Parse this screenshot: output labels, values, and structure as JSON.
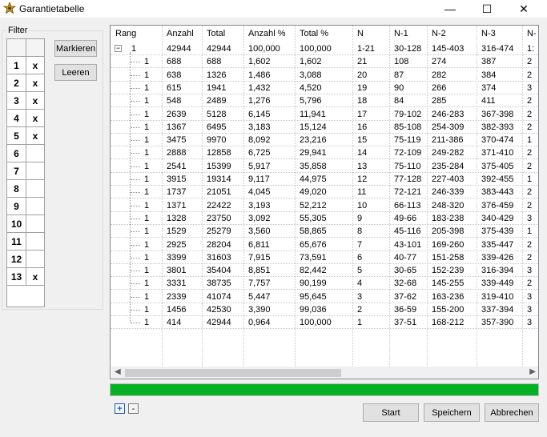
{
  "window": {
    "title": "Garantietabelle",
    "icon": "sheriff-star-icon",
    "min_glyph": "—",
    "max_glyph": "☐",
    "close_glyph": "✕"
  },
  "filter": {
    "label": "Filter",
    "rows": [
      {
        "num": "1",
        "mark": "x"
      },
      {
        "num": "2",
        "mark": "x"
      },
      {
        "num": "3",
        "mark": "x"
      },
      {
        "num": "4",
        "mark": "x"
      },
      {
        "num": "5",
        "mark": "x"
      },
      {
        "num": "6",
        "mark": ""
      },
      {
        "num": "7",
        "mark": ""
      },
      {
        "num": "8",
        "mark": ""
      },
      {
        "num": "9",
        "mark": ""
      },
      {
        "num": "10",
        "mark": ""
      },
      {
        "num": "11",
        "mark": ""
      },
      {
        "num": "12",
        "mark": ""
      },
      {
        "num": "13",
        "mark": "x"
      }
    ],
    "mark_button": "Markieren",
    "clear_button": "Leeren"
  },
  "table": {
    "columns": [
      "Rang",
      "Anzahl",
      "Total",
      "Anzahl %",
      "Total %",
      "N",
      "N-1",
      "N-2",
      "N-3",
      "N-"
    ],
    "root": {
      "collapse_glyph": "−",
      "rang": "1",
      "anzahl": "42944",
      "total": "42944",
      "anzahl_pct": "100,000",
      "total_pct": "100,000",
      "n": "1-21",
      "n1": "30-128",
      "n2": "145-403",
      "n3": "316-474",
      "n4": "1:"
    },
    "rows": [
      [
        "1",
        "688",
        "688",
        "1,602",
        "1,602",
        "21",
        "108",
        "274",
        "387",
        "2"
      ],
      [
        "1",
        "638",
        "1326",
        "1,486",
        "3,088",
        "20",
        "87",
        "282",
        "384",
        "2"
      ],
      [
        "1",
        "615",
        "1941",
        "1,432",
        "4,520",
        "19",
        "90",
        "266",
        "374",
        "3"
      ],
      [
        "1",
        "548",
        "2489",
        "1,276",
        "5,796",
        "18",
        "84",
        "285",
        "411",
        "2"
      ],
      [
        "1",
        "2639",
        "5128",
        "6,145",
        "11,941",
        "17",
        "79-102",
        "246-283",
        "367-398",
        "2"
      ],
      [
        "1",
        "1367",
        "6495",
        "3,183",
        "15,124",
        "16",
        "85-108",
        "254-309",
        "382-393",
        "2"
      ],
      [
        "1",
        "3475",
        "9970",
        "8,092",
        "23,216",
        "15",
        "75-119",
        "211-386",
        "370-474",
        "1"
      ],
      [
        "1",
        "2888",
        "12858",
        "6,725",
        "29,941",
        "14",
        "72-109",
        "249-282",
        "371-410",
        "2"
      ],
      [
        "1",
        "2541",
        "15399",
        "5,917",
        "35,858",
        "13",
        "75-110",
        "235-284",
        "375-405",
        "2"
      ],
      [
        "1",
        "3915",
        "19314",
        "9,117",
        "44,975",
        "12",
        "77-128",
        "227-403",
        "392-455",
        "1"
      ],
      [
        "1",
        "1737",
        "21051",
        "4,045",
        "49,020",
        "11",
        "72-121",
        "246-339",
        "383-443",
        "2"
      ],
      [
        "1",
        "1371",
        "22422",
        "3,193",
        "52,212",
        "10",
        "66-113",
        "248-320",
        "376-459",
        "2"
      ],
      [
        "1",
        "1328",
        "23750",
        "3,092",
        "55,305",
        "9",
        "49-66",
        "183-238",
        "340-429",
        "3"
      ],
      [
        "1",
        "1529",
        "25279",
        "3,560",
        "58,865",
        "8",
        "45-116",
        "205-398",
        "375-439",
        "1"
      ],
      [
        "1",
        "2925",
        "28204",
        "6,811",
        "65,676",
        "7",
        "43-101",
        "169-260",
        "335-447",
        "2"
      ],
      [
        "1",
        "3399",
        "31603",
        "7,915",
        "73,591",
        "6",
        "40-77",
        "151-258",
        "339-426",
        "2"
      ],
      [
        "1",
        "3801",
        "35404",
        "8,851",
        "82,442",
        "5",
        "30-65",
        "152-239",
        "316-394",
        "3"
      ],
      [
        "1",
        "3331",
        "38735",
        "7,757",
        "90,199",
        "4",
        "32-68",
        "145-255",
        "339-449",
        "2"
      ],
      [
        "1",
        "2339",
        "41074",
        "5,447",
        "95,645",
        "3",
        "37-62",
        "163-236",
        "319-410",
        "3"
      ],
      [
        "1",
        "1456",
        "42530",
        "3,390",
        "99,036",
        "2",
        "36-59",
        "155-200",
        "337-394",
        "3"
      ],
      [
        "1",
        "414",
        "42944",
        "0,964",
        "100,000",
        "1",
        "37-51",
        "168-212",
        "357-390",
        "3"
      ]
    ]
  },
  "progress": {
    "value": 1.0,
    "color": "#06b025"
  },
  "toolbar": {
    "plus": "+",
    "minus": "-",
    "start": "Start",
    "save": "Speichern",
    "cancel": "Abbrechen"
  }
}
